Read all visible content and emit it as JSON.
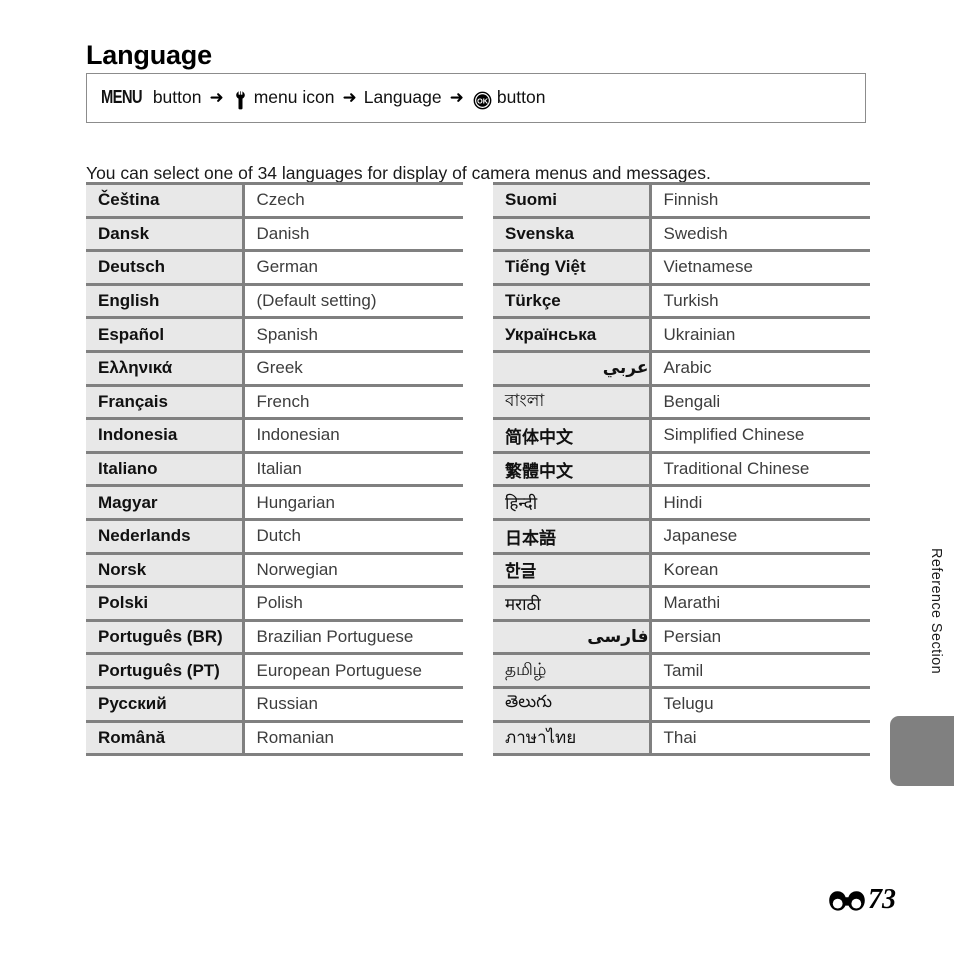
{
  "page": {
    "title": "Language",
    "intro": "You can select one of 34 languages for display of camera menus and messages.",
    "section_label": "Reference Section",
    "footer_page_number": "73",
    "footer_icon": "reference-section-glyph"
  },
  "nav_path": {
    "menu_word": "MENU",
    "button_word_1": "button",
    "arrow": "➜",
    "setup_icon": "wrench-icon",
    "menu_icon_label": "menu icon",
    "language_label": "Language",
    "ok_icon": "ok-button-icon",
    "button_word_2": "button"
  },
  "colors": {
    "rule": "#808080",
    "native_cell_bg": "#e8e8e8",
    "english_text": "#3d3d3d",
    "tab_gray": "#808080",
    "box_border": "#8c8c8c"
  },
  "tables": {
    "left": [
      {
        "native": "Čeština",
        "english": "Czech",
        "script": "latin"
      },
      {
        "native": "Dansk",
        "english": "Danish",
        "script": "latin"
      },
      {
        "native": "Deutsch",
        "english": "German",
        "script": "latin"
      },
      {
        "native": "English",
        "english": "(Default setting)",
        "script": "latin"
      },
      {
        "native": "Español",
        "english": "Spanish",
        "script": "latin"
      },
      {
        "native": "Ελληνικά",
        "english": "Greek",
        "script": "latin"
      },
      {
        "native": "Français",
        "english": "French",
        "script": "latin"
      },
      {
        "native": "Indonesia",
        "english": "Indonesian",
        "script": "latin"
      },
      {
        "native": "Italiano",
        "english": "Italian",
        "script": "latin"
      },
      {
        "native": "Magyar",
        "english": "Hungarian",
        "script": "latin"
      },
      {
        "native": "Nederlands",
        "english": "Dutch",
        "script": "latin"
      },
      {
        "native": "Norsk",
        "english": "Norwegian",
        "script": "latin"
      },
      {
        "native": "Polski",
        "english": "Polish",
        "script": "latin"
      },
      {
        "native": "Português (BR)",
        "english": "Brazilian Portuguese",
        "script": "latin"
      },
      {
        "native": "Português (PT)",
        "english": "European Portuguese",
        "script": "latin"
      },
      {
        "native": "Русский",
        "english": "Russian",
        "script": "latin"
      },
      {
        "native": "Română",
        "english": "Romanian",
        "script": "latin"
      }
    ],
    "right": [
      {
        "native": "Suomi",
        "english": "Finnish",
        "script": "latin"
      },
      {
        "native": "Svenska",
        "english": "Swedish",
        "script": "latin"
      },
      {
        "native": "Tiếng Việt",
        "english": "Vietnamese",
        "script": "latin"
      },
      {
        "native": "Türkçe",
        "english": "Turkish",
        "script": "latin"
      },
      {
        "native": "Українська",
        "english": "Ukrainian",
        "script": "latin"
      },
      {
        "native": "عربي",
        "english": "Arabic",
        "script": "rtl"
      },
      {
        "native": "বাংলা",
        "english": "Bengali",
        "script": "indic"
      },
      {
        "native": "简体中文",
        "english": "Simplified Chinese",
        "script": "cjk"
      },
      {
        "native": "繁體中文",
        "english": "Traditional Chinese",
        "script": "cjk"
      },
      {
        "native": "हिन्दी",
        "english": "Hindi",
        "script": "indic"
      },
      {
        "native": "日本語",
        "english": "Japanese",
        "script": "cjk"
      },
      {
        "native": "한글",
        "english": "Korean",
        "script": "cjk"
      },
      {
        "native": "मराठी",
        "english": "Marathi",
        "script": "indic"
      },
      {
        "native": "فارسی",
        "english": "Persian",
        "script": "rtl"
      },
      {
        "native": "தமிழ்",
        "english": "Tamil",
        "script": "indic"
      },
      {
        "native": "తెలుగు",
        "english": "Telugu",
        "script": "indic"
      },
      {
        "native": "ภาษาไทย",
        "english": "Thai",
        "script": "thai"
      }
    ]
  }
}
